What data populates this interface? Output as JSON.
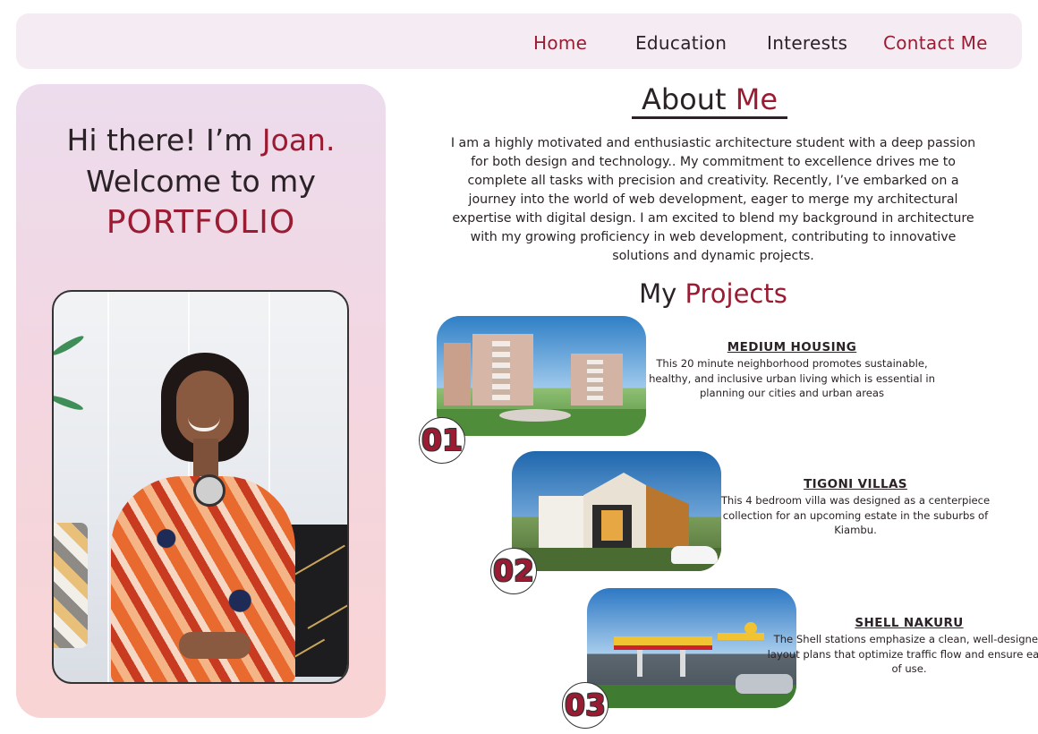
{
  "nav": {
    "home": "Home",
    "education": "Education",
    "interests": "Interests",
    "contact": "Contact Me"
  },
  "hero": {
    "greeting_prefix": "Hi there! I’m ",
    "name": "Joan.",
    "welcome": "Welcome to my",
    "portfolio": "PORTFOLIO",
    "photo": "portrait-photo"
  },
  "about": {
    "title_prefix": "About ",
    "title_highlight": "Me",
    "body": "I am a highly motivated and enthusiastic architecture student with a deep passion for both design and technology.. My commitment to excellence drives me to complete all tasks with precision and creativity. Recently, I’ve embarked on a journey into the world of web development, eager to merge my architectural expertise with digital design. I am excited to blend my background in architecture with my growing proficiency in web development, contributing to innovative solutions and dynamic projects."
  },
  "projects": {
    "title_prefix": "My ",
    "title_highlight": "Projects",
    "items": [
      {
        "number": "01",
        "title": "MEDIUM HOUSING",
        "description": "This 20 minute neighborhood promotes sustainable, healthy, and inclusive urban living which is essential in planning our cities and urban areas"
      },
      {
        "number": "02",
        "title": "TIGONI VILLAS",
        "description": "This 4 bedroom villa was designed as a centerpiece collection for an upcoming estate in the suburbs of Kiambu."
      },
      {
        "number": "03",
        "title": "SHELL NAKURU",
        "description": "The Shell stations emphasize a clean, well-designed layout plans that optimize traffic flow and ensure ease of use."
      }
    ]
  },
  "colors": {
    "accent": "#9b1c32",
    "text": "#2a2226",
    "nav_bg": "#f5ecf3"
  }
}
